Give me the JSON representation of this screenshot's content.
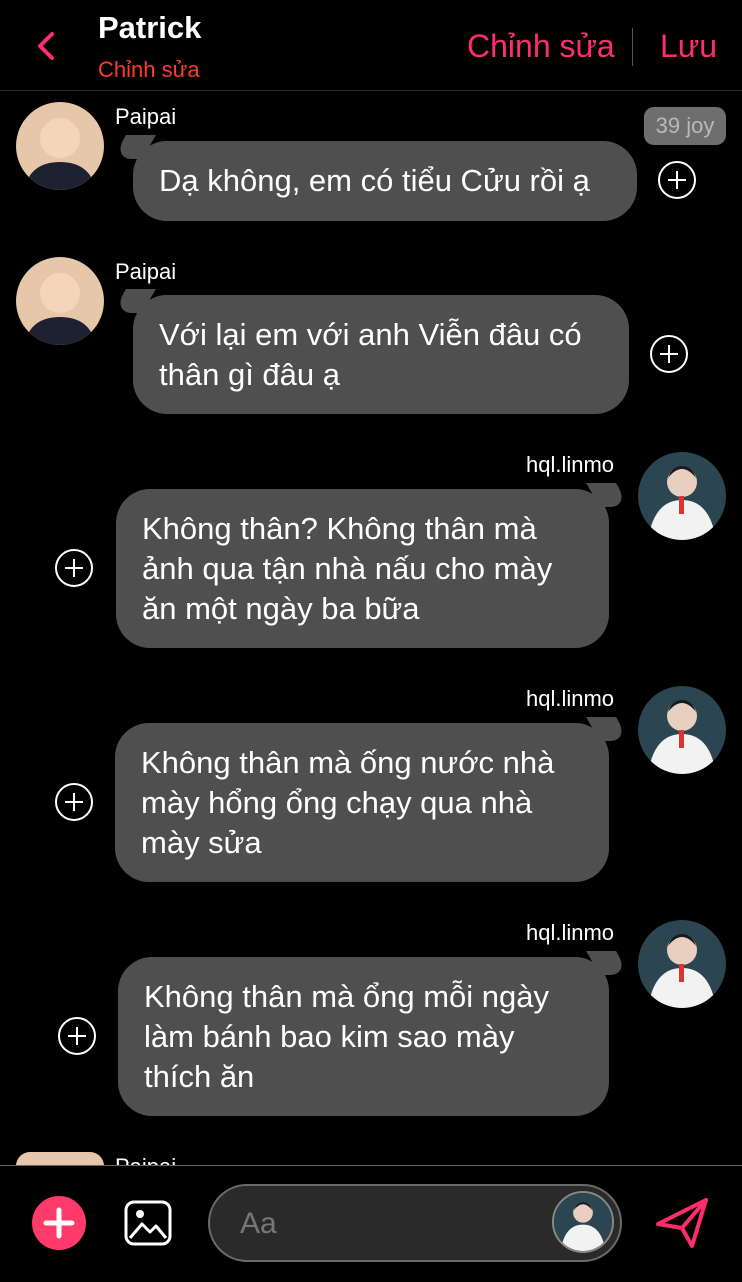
{
  "header": {
    "title": "Patrick",
    "subtitle": "Chỉnh sửa",
    "edit_label": "Chỉnh sửa",
    "save_label": "Lưu"
  },
  "badge": "39 joy",
  "messages": [
    {
      "sender": "Paipai",
      "text": "Dạ không, em có tiểu Cửu rồi ạ",
      "side": "left"
    },
    {
      "sender": "Paipai",
      "text": "Với lại em với anh Viễn đâu có thân gì đâu ạ",
      "side": "left"
    },
    {
      "sender": "hql.linmo",
      "text": "Không thân? Không thân mà ảnh qua tận nhà nấu cho mày ăn một ngày ba bữa",
      "side": "right"
    },
    {
      "sender": "hql.linmo",
      "text": "Không thân mà ống nước nhà mày hổng ổng chạy qua nhà mày sửa",
      "side": "right"
    },
    {
      "sender": "hql.linmo",
      "text": "Không thân mà ổng mỗi ngày làm bánh bao kim sao mày thích ăn",
      "side": "right"
    },
    {
      "sender": "Paipai",
      "text": "",
      "side": "left"
    }
  ],
  "composer": {
    "placeholder": "Aa"
  },
  "icons": {
    "back": "chevron-left-icon",
    "add": "plus-icon",
    "image": "image-icon",
    "send": "send-icon",
    "add_reaction": "plus-circle-icon"
  },
  "colors": {
    "accent": "#ff2d6f",
    "subtitle": "#ff3b30",
    "bubble": "#4f4f4f",
    "background": "#000000"
  }
}
